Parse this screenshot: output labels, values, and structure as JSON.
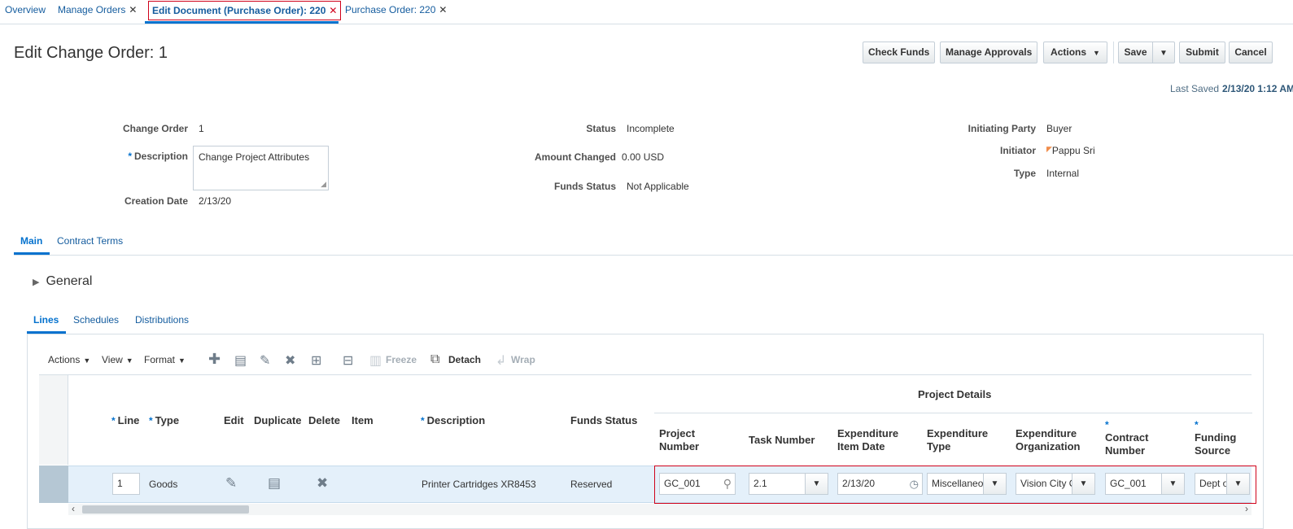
{
  "top_tabs": [
    {
      "label": "Overview"
    },
    {
      "label": "Manage Orders"
    },
    {
      "label": "Edit Document (Purchase Order): 220"
    },
    {
      "label": "Purchase Order: 220"
    }
  ],
  "close_glyph": "✕",
  "page_title": "Edit Change Order: 1",
  "buttons": {
    "check_funds": "Check Funds",
    "manage_approvals": "Manage Approvals",
    "actions": "Actions",
    "save": "Save",
    "submit": "Submit",
    "cancel": "Cancel"
  },
  "last_saved": {
    "label": "Last Saved",
    "value": "2/13/20 1:12 AM"
  },
  "header": {
    "change_order": {
      "label": "Change Order",
      "value": "1"
    },
    "description": {
      "label": "Description",
      "value": "Change Project Attributes"
    },
    "creation_date": {
      "label": "Creation Date",
      "value": "2/13/20"
    },
    "status": {
      "label": "Status",
      "value": "Incomplete"
    },
    "amount_changed": {
      "label": "Amount Changed",
      "value": "0.00",
      "currency": "USD"
    },
    "funds_status": {
      "label": "Funds Status",
      "value": "Not Applicable"
    },
    "initiating_party": {
      "label": "Initiating Party",
      "value": "Buyer"
    },
    "initiator": {
      "label": "Initiator",
      "value": "Pappu Sri"
    },
    "type": {
      "label": "Type",
      "value": "Internal"
    }
  },
  "section_tabs": [
    "Main",
    "Contract Terms"
  ],
  "general_label": "General",
  "line_tabs": [
    "Lines",
    "Schedules",
    "Distributions"
  ],
  "toolbar": {
    "actions": "Actions",
    "view": "View",
    "format": "Format",
    "freeze": "Freeze",
    "detach": "Detach",
    "wrap": "Wrap"
  },
  "table": {
    "group_header": "Project Details",
    "columns": {
      "line": "Line",
      "type": "Type",
      "edit": "Edit",
      "duplicate": "Duplicate",
      "delete": "Delete",
      "item": "Item",
      "description": "Description",
      "funds_status": "Funds Status",
      "project_number_1": "Project",
      "project_number_2": "Number",
      "task_number": "Task Number",
      "exp_item_date_1": "Expenditure",
      "exp_item_date_2": "Item Date",
      "exp_type_1": "Expenditure",
      "exp_type_2": "Type",
      "exp_org_1": "Expenditure",
      "exp_org_2": "Organization",
      "contract_number_1": "Contract",
      "contract_number_2": "Number",
      "funding_source_1": "Funding",
      "funding_source_2": "Source"
    },
    "row": {
      "line": "1",
      "type": "Goods",
      "description": "Printer Cartridges XR8453",
      "funds_status": "Reserved",
      "project_number": "GC_001",
      "task_number": "2.1",
      "exp_item_date": "2/13/20",
      "exp_type": "Miscellaneous",
      "exp_org": "Vision City Operations",
      "contract_number": "GC_001",
      "funding_source": "Dept of Energy"
    }
  }
}
